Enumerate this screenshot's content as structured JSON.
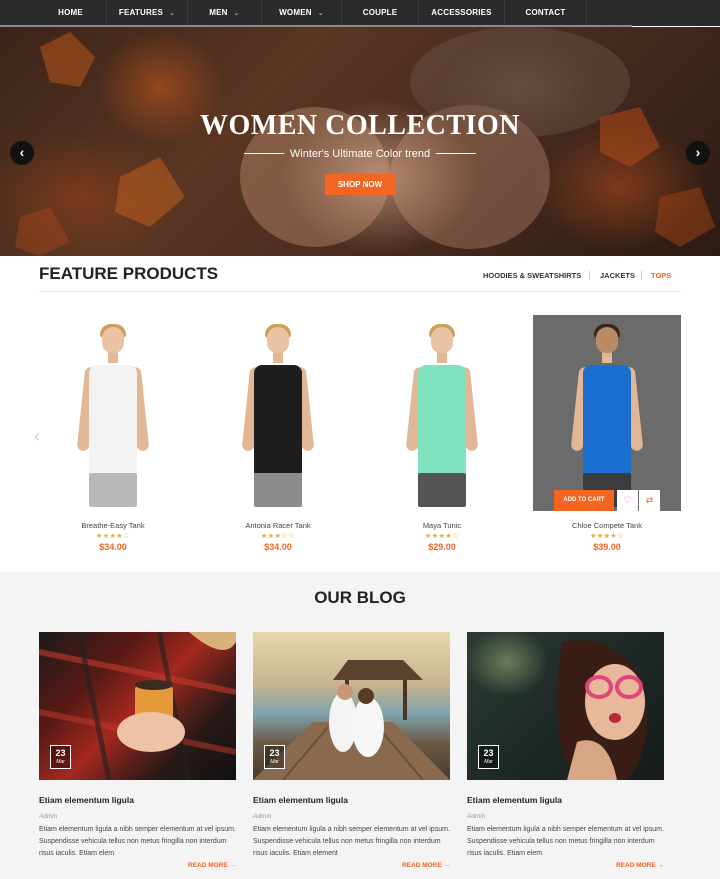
{
  "nav": {
    "items": [
      {
        "label": "HOME",
        "dropdown": false
      },
      {
        "label": "FEATURES",
        "dropdown": true
      },
      {
        "label": "MEN",
        "dropdown": true
      },
      {
        "label": "WOMEN",
        "dropdown": true
      },
      {
        "label": "COUPLE",
        "dropdown": false
      },
      {
        "label": "ACCESSORIES",
        "dropdown": false
      },
      {
        "label": "CONTACT",
        "dropdown": false
      }
    ],
    "chevron": "⌄"
  },
  "hero": {
    "title": "WOMEN COLLECTION",
    "subtitle": "Winter's Ultimate Color trend",
    "button": "SHOP NOW",
    "prev_icon": "‹",
    "next_icon": "›"
  },
  "featured": {
    "title": "FEATURE PRODUCTS",
    "tabs": [
      {
        "label": "HOODIES & SWEATSHIRTS",
        "active": false
      },
      {
        "label": "JACKETS",
        "active": false
      },
      {
        "label": "TOPS",
        "active": true
      }
    ],
    "prev_icon": "‹",
    "next_icon": "›",
    "products": [
      {
        "name": "Breathe-Easy Tank",
        "stars": "★★★★☆",
        "rating": 4,
        "price": "$34.00",
        "top_color": "#f3f3f3",
        "bottom_color": "#b9b9b9"
      },
      {
        "name": "Antonia Racer Tank",
        "stars": "★★★☆☆",
        "rating": 3,
        "price": "$34.00",
        "top_color": "#1e1e1e",
        "bottom_color": "#8c8c8c"
      },
      {
        "name": "Maya Tunic",
        "stars": "★★★★☆",
        "rating": 4,
        "price": "$29.00",
        "top_color": "#7fe3c0",
        "bottom_color": "#555555"
      },
      {
        "name": "Chloe Compete Tank",
        "stars": "★★★★☆",
        "rating": 4,
        "price": "$39.00",
        "top_color": "#1a6fd1",
        "bottom_color": "#3c3c3c"
      }
    ],
    "hover": {
      "add_to_cart": "ADD TO CART",
      "wishlist_icon": "♡",
      "compare_icon": "⇄"
    }
  },
  "blog": {
    "title": "OUR BLOG",
    "posts": [
      {
        "day": "23",
        "month": "Mar",
        "title": "Etiam elementum ligula",
        "author": "Admin",
        "excerpt": "Etiam elementum ligula a nibh semper elementum at vel ipsum. Suspendisse vehicula tellus non metus fringilla non interdum risus iaculis. Etiam elem",
        "read_more": "READ MORE →"
      },
      {
        "day": "23",
        "month": "Mar",
        "title": "Etiam elementum ligula",
        "author": "Admin",
        "excerpt": "Etiam elementum ligula a nibh semper elementum at vel ipsum. Suspendisse vehicula tellus non metus fringilla non interdum risus iaculis. Etiam element",
        "read_more": "READ MORE →"
      },
      {
        "day": "23",
        "month": "Mar",
        "title": "Etiam elementum ligula",
        "author": "Admin",
        "excerpt": "Etiam elementum ligula a nibh semper elementum at vel ipsum. Suspendisse vehicula tellus non metus fringilla non interdum risus iaculis. Etiam elem",
        "read_more": "READ MORE →"
      }
    ]
  },
  "colors": {
    "accent": "#f26522",
    "nav_bg": "#2b2b2b",
    "star": "#f5a623",
    "blog_bg": "#f4f4f4"
  }
}
